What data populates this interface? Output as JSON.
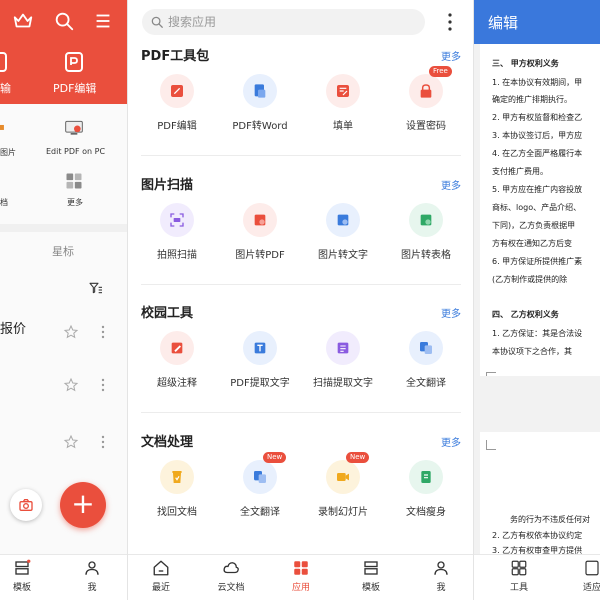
{
  "left": {
    "header": {
      "transfer_label": "输",
      "pdf_edit_label": "PDF编辑"
    },
    "tools": {
      "image_label": "图片",
      "edit_pc_label": "Edit PDF on PC",
      "doc_label": "档",
      "more_label": "更多"
    },
    "starred_tab": "星标",
    "file_title": "报价",
    "nav": {
      "template": "模板",
      "me": "我"
    }
  },
  "mid": {
    "search_placeholder": "搜索应用",
    "sections": [
      {
        "title": "PDF工具包",
        "more": "更多",
        "tools": [
          {
            "label": "PDF编辑"
          },
          {
            "label": "PDF转Word"
          },
          {
            "label": "填单"
          },
          {
            "label": "设置密码",
            "badge": "Free"
          }
        ]
      },
      {
        "title": "图片扫描",
        "more": "更多",
        "tools": [
          {
            "label": "拍照扫描"
          },
          {
            "label": "图片转PDF"
          },
          {
            "label": "图片转文字"
          },
          {
            "label": "图片转表格"
          }
        ]
      },
      {
        "title": "校园工具",
        "more": "更多",
        "tools": [
          {
            "label": "超级注释"
          },
          {
            "label": "PDF提取文字"
          },
          {
            "label": "扫描提取文字"
          },
          {
            "label": "全文翻译"
          }
        ]
      },
      {
        "title": "文档处理",
        "more": "更多",
        "tools": [
          {
            "label": "找回文档"
          },
          {
            "label": "全文翻译",
            "badge": "New"
          },
          {
            "label": "录制幻灯片",
            "badge": "New"
          },
          {
            "label": "文档瘦身"
          }
        ]
      }
    ],
    "nav": [
      {
        "label": "最近"
      },
      {
        "label": "云文档"
      },
      {
        "label": "应用"
      },
      {
        "label": "模板"
      },
      {
        "label": "我"
      }
    ],
    "accent": "#ea4f3d",
    "link_color": "#3a7bdc"
  },
  "right": {
    "title": "编辑",
    "doc_lines": [
      "三、    甲方权利义务",
      "1.  在本协议有效期间，甲",
      "     确定的推广排期执行。",
      "2.  甲方有权监督和检查乙",
      "3.  本协议签订后，甲方应",
      "4.  在乙方全面严格履行本",
      "     支付推广费用。",
      "5.  甲方应在推广内容投放",
      "     商标、logo、产品介绍、",
      "     下同)，乙方负责根据甲",
      "     方有权在通知乙方后变",
      "6.  甲方保证所提供推广素",
      "     (乙方制作或提供的除",
      "四、    乙方权利义务",
      "1.  乙方保证：其是合法设",
      "     本协议项下之合作，其"
    ],
    "doc_lines_page2": [
      "务的行为不违反任何对",
      "2.  乙方有权依本协议约定",
      "3.  乙方有权审查甲方提供"
    ],
    "nav": {
      "tools": "工具",
      "adapt": "适应"
    },
    "header_color": "#3a78dc"
  }
}
